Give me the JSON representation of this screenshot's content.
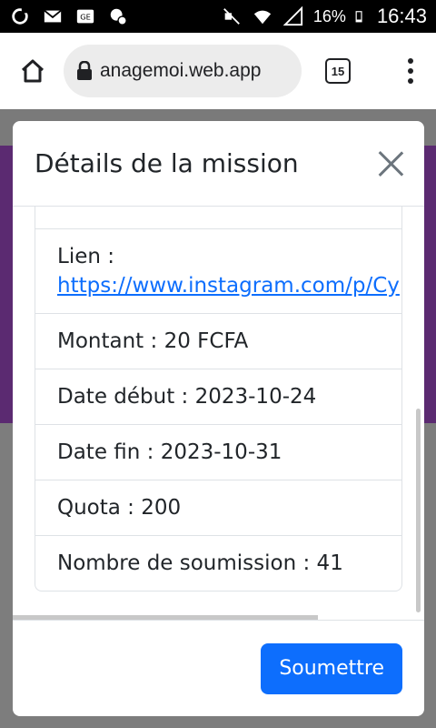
{
  "status_bar": {
    "battery_percent": "16%",
    "time": "16:43",
    "icons": [
      "sync-icon",
      "mail-icon",
      "sim-card-icon",
      "location-icon",
      "mute-icon",
      "wifi-icon",
      "signal-icon",
      "battery-icon"
    ]
  },
  "browser": {
    "url": "anagemoi.web.app",
    "tab_count": "15"
  },
  "modal": {
    "title": "Détails de la mission",
    "link_label": "Lien :",
    "link_url": "https://www.instagram.com/p/Cy",
    "items": [
      "Montant : 20 FCFA",
      "Date début : 2023-10-24",
      "Date fin : 2023-10-31",
      "Quota : 200",
      "Nombre de soumission : 41"
    ],
    "submit_label": "Soumettre"
  },
  "colors": {
    "primary": "#0d6efd",
    "purple_bg": "#5b2a71"
  }
}
